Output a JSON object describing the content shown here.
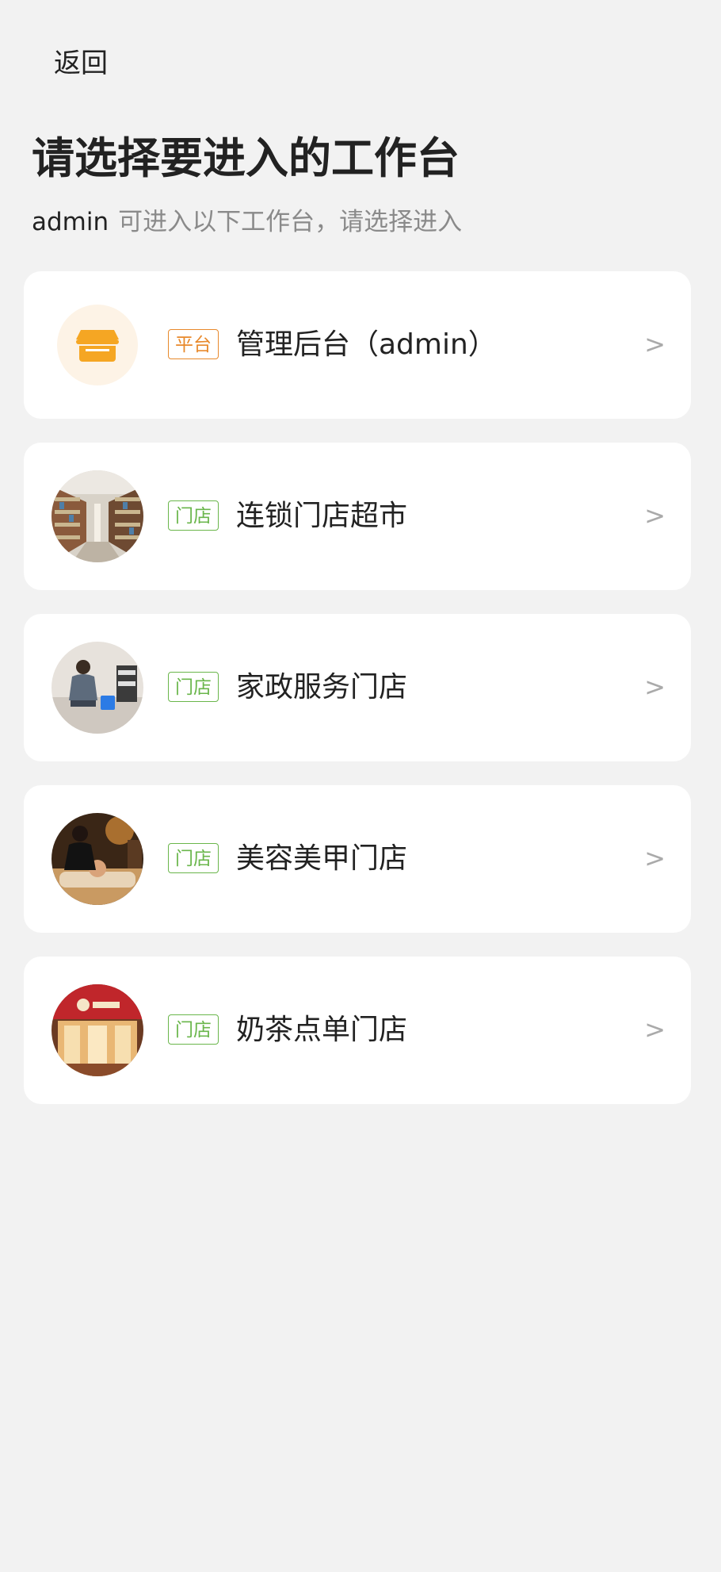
{
  "header": {
    "back_label": "返回",
    "title": "请选择要进入的工作台",
    "subtitle_user": "admin",
    "subtitle_text": "可进入以下工作台，请选择进入"
  },
  "workspaces": [
    {
      "tag": "平台",
      "name": "管理后台（admin）",
      "icon": "store-icon",
      "tag_color": "#e8892b"
    },
    {
      "tag": "门店",
      "name": "连锁门店超市",
      "icon": "supermarket-photo",
      "tag_color": "#6ab64b"
    },
    {
      "tag": "门店",
      "name": "家政服务门店",
      "icon": "housekeeping-photo",
      "tag_color": "#6ab64b"
    },
    {
      "tag": "门店",
      "name": "美容美甲门店",
      "icon": "beauty-salon-photo",
      "tag_color": "#6ab64b"
    },
    {
      "tag": "门店",
      "name": "奶茶点单门店",
      "icon": "milk-tea-shop-photo",
      "tag_color": "#6ab64b"
    }
  ],
  "chevron": ">",
  "colors": {
    "background": "#f2f2f2",
    "card": "#ffffff",
    "platform_accent": "#e8892b",
    "store_accent": "#6ab64b"
  }
}
